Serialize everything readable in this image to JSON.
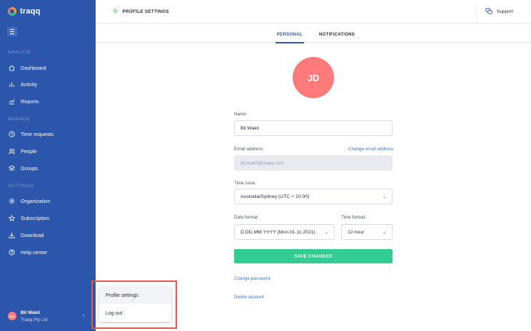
{
  "app": {
    "logo_text": "traqq"
  },
  "sidebar": {
    "sections": {
      "analyze": "ANALYZE",
      "manage": "MANAGE",
      "settings": "SETTINGS"
    },
    "items": [
      {
        "label": "Dashboard",
        "icon": "home-icon"
      },
      {
        "label": "Activity",
        "icon": "activity-icon"
      },
      {
        "label": "Reports",
        "icon": "reports-icon"
      },
      {
        "label": "Time requests",
        "icon": "clock-icon"
      },
      {
        "label": "People",
        "icon": "people-icon"
      },
      {
        "label": "Groups",
        "icon": "layers-icon"
      },
      {
        "label": "Organization",
        "icon": "gear-icon"
      },
      {
        "label": "Subscription",
        "icon": "star-icon"
      },
      {
        "label": "Download",
        "icon": "download-icon"
      },
      {
        "label": "Help center",
        "icon": "help-icon"
      }
    ],
    "user": {
      "initials": "BW",
      "name": "Bil Wakil",
      "org": "Traqq Pty Ltd"
    }
  },
  "header": {
    "title": "PROFILE SETTINGS",
    "support_label": "Support"
  },
  "tabs": [
    {
      "label": "PERSONAL",
      "active": true
    },
    {
      "label": "NOTIFICATIONS",
      "active": false
    }
  ],
  "profile": {
    "avatar_initials": "JD",
    "name_label": "Name:",
    "name_value": "Bil Wakil",
    "email_label": "Email address:",
    "change_email_link": "Change email address",
    "email_value": "bil.wakil@traqq.com",
    "timezone_label": "Time zone:",
    "timezone_value": "Australia/Sydney (UTC + 10:00)",
    "date_format_label": "Date format:",
    "date_format_value": "D.DD.MM.YYYY (Mon.01.11.2021)",
    "time_format_label": "Time format:",
    "time_format_value": "12-hour",
    "save_label": "SAVE CHANGES",
    "change_password_link": "Change password",
    "delete_account_link": "Delete account"
  },
  "popup": {
    "items": [
      {
        "label": "Profile settings",
        "active": true
      },
      {
        "label": "Log out",
        "active": false
      }
    ]
  },
  "colors": {
    "sidebar": "#2c56ac",
    "accent": "#2c56ac",
    "save_button": "#33cc92",
    "avatar": "#ff7b7b",
    "highlight": "#e35a4a"
  }
}
